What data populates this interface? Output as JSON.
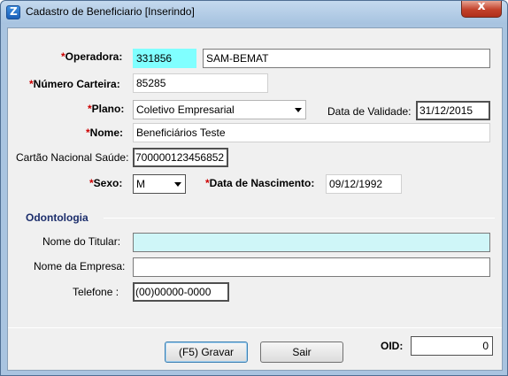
{
  "window": {
    "title": "Cadastro de Beneficiario [Inserindo]"
  },
  "form": {
    "operadora": {
      "label": "Operadora:",
      "code": "331856",
      "name": "SAM-BEMAT"
    },
    "numero_carteira": {
      "label": "Número Carteira:",
      "value": "85285"
    },
    "plano": {
      "label": "Plano:",
      "value": "Coletivo Empresarial"
    },
    "data_validade": {
      "label": "Data de Validade:",
      "value": "31/12/2015"
    },
    "nome": {
      "label": "Nome:",
      "value": "Beneficiários Teste"
    },
    "cartao_nacional": {
      "label": "Cartão Nacional Saúde:",
      "value": "700000123456852"
    },
    "sexo": {
      "label": "Sexo:",
      "value": "M"
    },
    "data_nascimento": {
      "label": "Data de Nascimento:",
      "value": "09/12/1992"
    },
    "required_marker": "*"
  },
  "odontologia": {
    "title": "Odontologia",
    "nome_titular": {
      "label": "Nome do Titular:",
      "value": ""
    },
    "nome_empresa": {
      "label": "Nome da Empresa:",
      "value": ""
    },
    "telefone": {
      "label": "Telefone :",
      "value": "(00)00000-0000"
    }
  },
  "footer": {
    "gravar_label": "(F5)  Gravar",
    "sair_label": "Sair",
    "oid_label": "OID:",
    "oid_value": "0"
  }
}
